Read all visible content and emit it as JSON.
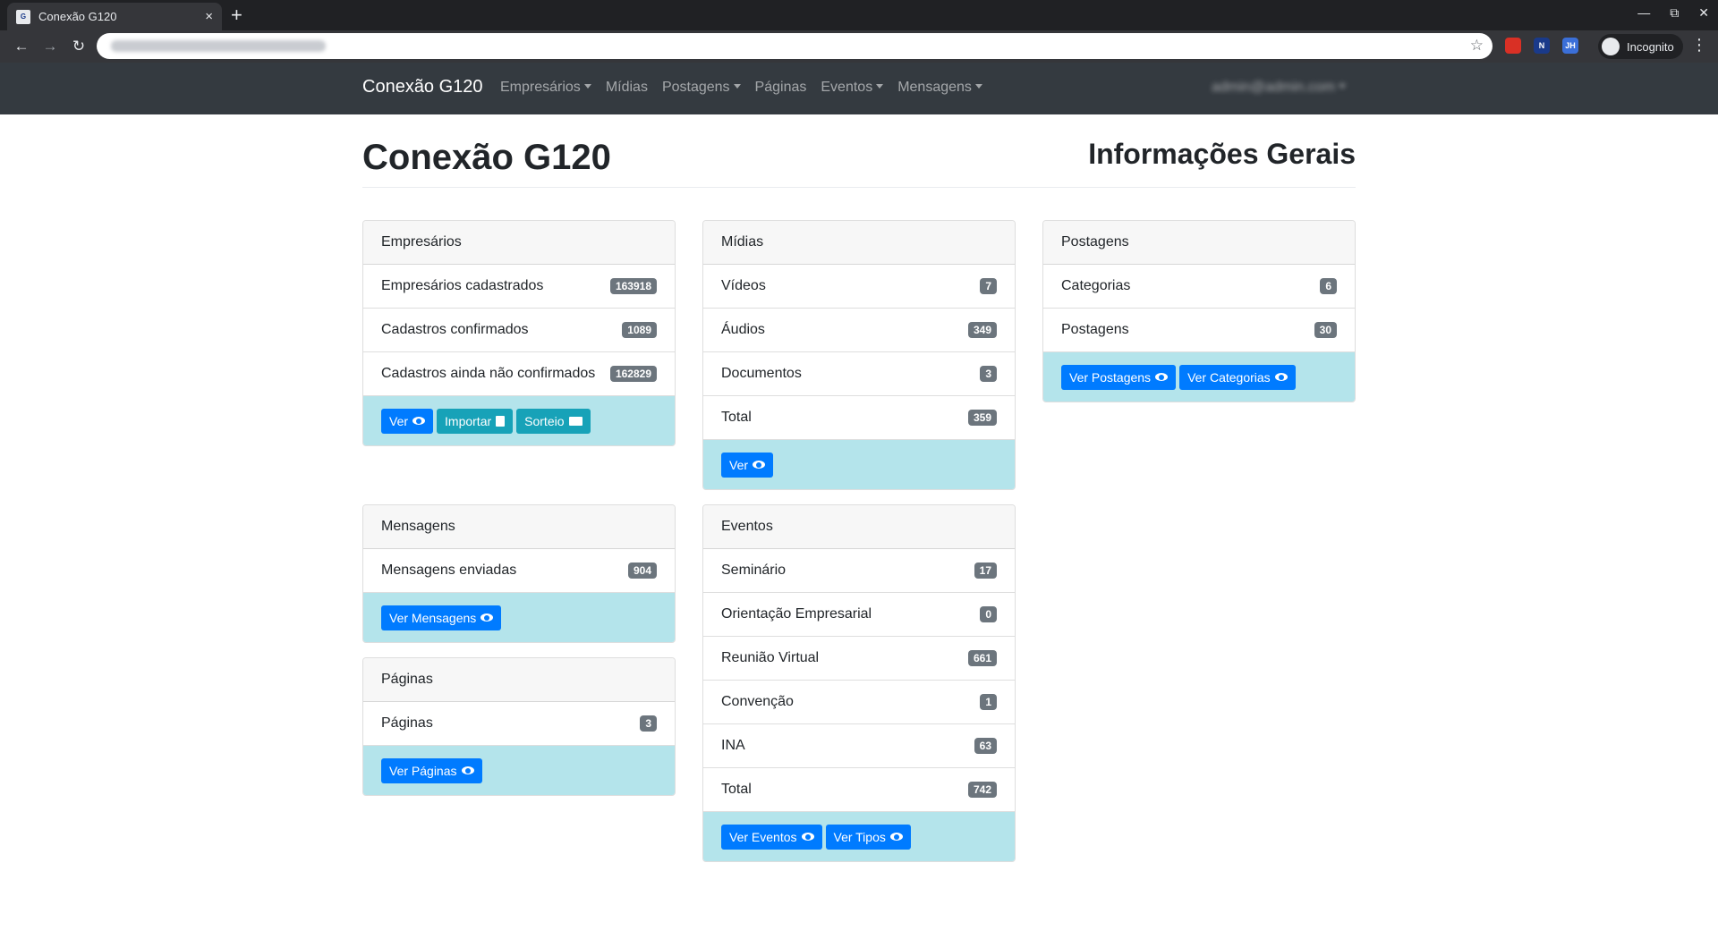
{
  "browser": {
    "tab_title": "Conexão G120",
    "tab_close": "×",
    "new_tab": "+",
    "incognito_label": "Incognito",
    "extensions": [
      {
        "name": "red-extension",
        "label": "",
        "color": "#d93025"
      },
      {
        "name": "n-extension",
        "label": "N",
        "color": "#1a3a8a"
      },
      {
        "name": "jh-extension",
        "label": "JH",
        "color": "#3b6fd8"
      }
    ]
  },
  "navbar": {
    "brand": "Conexão G120",
    "links": [
      {
        "label": "Empresários"
      },
      {
        "label": "Mídias"
      },
      {
        "label": "Postagens"
      },
      {
        "label": "Páginas"
      },
      {
        "label": "Eventos"
      },
      {
        "label": "Mensagens"
      }
    ],
    "user": "admin@admin.com"
  },
  "page": {
    "title": "Conexão G120",
    "subtitle": "Informações Gerais"
  },
  "cards": {
    "empresarios": {
      "title": "Empresários",
      "items": [
        {
          "label": "Empresários cadastrados",
          "count": "163918"
        },
        {
          "label": "Cadastros confirmados",
          "count": "1089"
        },
        {
          "label": "Cadastros ainda não confirmados",
          "count": "162829"
        }
      ],
      "buttons": [
        "Ver",
        "Importar",
        "Sorteio"
      ]
    },
    "midias": {
      "title": "Mídias",
      "items": [
        {
          "label": "Vídeos",
          "count": "7"
        },
        {
          "label": "Áudios",
          "count": "349"
        },
        {
          "label": "Documentos",
          "count": "3"
        },
        {
          "label": "Total",
          "count": "359"
        }
      ],
      "buttons": [
        "Ver"
      ]
    },
    "postagens": {
      "title": "Postagens",
      "items": [
        {
          "label": "Categorias",
          "count": "6"
        },
        {
          "label": "Postagens",
          "count": "30"
        }
      ],
      "buttons": [
        "Ver Postagens",
        "Ver Categorias"
      ]
    },
    "mensagens": {
      "title": "Mensagens",
      "items": [
        {
          "label": "Mensagens enviadas",
          "count": "904"
        }
      ],
      "buttons": [
        "Ver Mensagens"
      ]
    },
    "paginas": {
      "title": "Páginas",
      "items": [
        {
          "label": "Páginas",
          "count": "3"
        }
      ],
      "buttons": [
        "Ver Páginas"
      ]
    },
    "eventos": {
      "title": "Eventos",
      "items": [
        {
          "label": "Seminário",
          "count": "17"
        },
        {
          "label": "Orientação Empresarial",
          "count": "0"
        },
        {
          "label": "Reunião Virtual",
          "count": "661"
        },
        {
          "label": "Convenção",
          "count": "1"
        },
        {
          "label": "INA",
          "count": "63"
        },
        {
          "label": "Total",
          "count": "742"
        }
      ],
      "buttons": [
        "Ver Eventos",
        "Ver Tipos"
      ]
    }
  },
  "colors": {
    "navbar_bg": "#343a40",
    "card_footer_bg": "#b4e4eb",
    "btn_primary": "#007bff",
    "btn_info": "#17a2b8",
    "badge_bg": "#6c757d"
  }
}
